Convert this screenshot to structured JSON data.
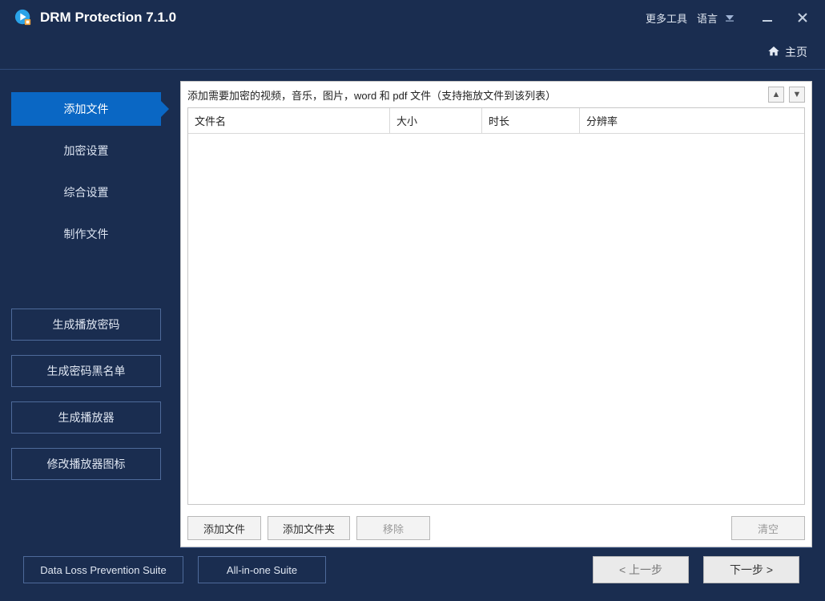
{
  "app": {
    "title": "DRM Protection 7.1.0"
  },
  "titlebar": {
    "more_tools": "更多工具",
    "language": "语言"
  },
  "home": {
    "label": "主页"
  },
  "sidebar": {
    "nav": [
      {
        "label": "添加文件",
        "active": true
      },
      {
        "label": "加密设置",
        "active": false
      },
      {
        "label": "综合设置",
        "active": false
      },
      {
        "label": "制作文件",
        "active": false
      }
    ],
    "actions": {
      "gen_play_pwd": "生成播放密码",
      "gen_pwd_blacklist": "生成密码黑名单",
      "gen_player": "生成播放器",
      "modify_player_icon": "修改播放器图标"
    }
  },
  "content": {
    "hint": "添加需要加密的视频，音乐，图片，word 和 pdf 文件（支持拖放文件到该列表）",
    "columns": {
      "name": "文件名",
      "size": "大小",
      "duration": "时长",
      "resolution": "分辨率"
    },
    "rows": [],
    "buttons": {
      "add_file": "添加文件",
      "add_folder": "添加文件夹",
      "remove": "移除",
      "clear": "清空"
    }
  },
  "footer": {
    "dlp_suite": "Data Loss Prevention Suite",
    "aio_suite": "All-in-one Suite",
    "prev": "< 上一步",
    "next": "下一步 >"
  }
}
